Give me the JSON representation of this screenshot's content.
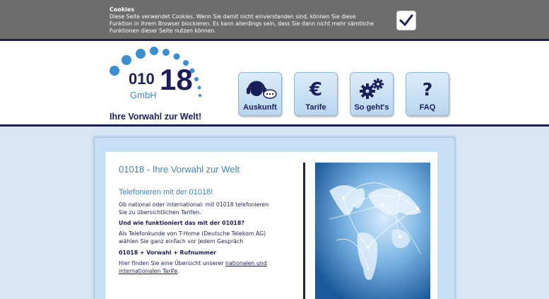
{
  "cookie": {
    "title": "Cookies",
    "message": "Diese Seite verwendet Cookies. Wenn Sie damit nicht einverstanden sind, können Sie diese Funktion in Ihrem Browser blockieren. Es kann allerdings sein, dass Sie dann nicht mehr sämtliche Funktionen dieser Seite nutzen können.",
    "accept_icon": "checkmark-icon"
  },
  "logo": {
    "prefix": "010",
    "number": "18",
    "company": "GmbH"
  },
  "tagline": "Ihre Vorwahl zur Welt!",
  "nav": [
    {
      "label": "Auskunft",
      "icon": "headset-chat-icon"
    },
    {
      "label": "Tarife",
      "icon": "euro-icon"
    },
    {
      "label": "So geht's",
      "icon": "gears-icon"
    },
    {
      "label": "FAQ",
      "icon": "question-mark-icon"
    }
  ],
  "main": {
    "title": "01018 - Ihre Vorwahl zur Welt",
    "subtitle": "Telefonieren mit der 01018!",
    "intro": "Ob national oder international: mit 01018 telefonieren Sie zu übersichtlichen Tarifen.",
    "question": "Und wie funktioniert das mit der 01018?",
    "explanation": "Als Telefonkunde von T-Home (Deutsche Telekom AG) wählen Sie ganz einfach vor jedem Gespräch",
    "dial_formula": "01018 + Vorwahl + Rufnummer",
    "overview_prefix": "Hier finden Sie eine Übersicht unserer ",
    "overview_link": "nationalen und internationalen Tarife",
    "overview_suffix": "."
  },
  "colors": {
    "navy": "#1a1f5c",
    "accent": "#3a84c6",
    "cookie_bg": "#6d6d6d",
    "page_bg": "#d8e6f3"
  }
}
